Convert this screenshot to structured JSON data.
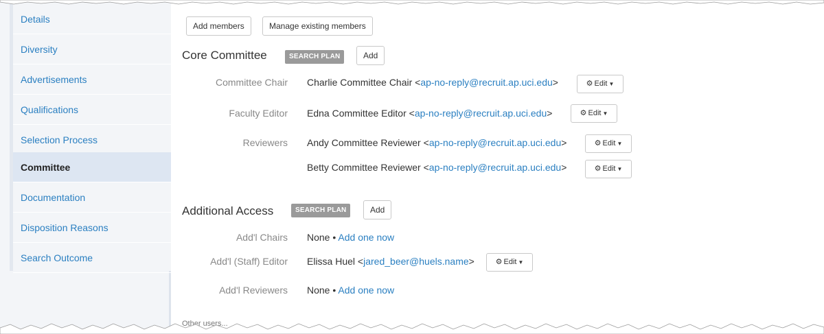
{
  "sidebar": {
    "items": [
      {
        "label": "Details",
        "active": false
      },
      {
        "label": "Diversity",
        "active": false
      },
      {
        "label": "Advertisements",
        "active": false
      },
      {
        "label": "Qualifications",
        "active": false
      },
      {
        "label": "Selection Process",
        "active": false
      },
      {
        "label": "Committee",
        "active": true
      },
      {
        "label": "Documentation",
        "active": false
      },
      {
        "label": "Disposition Reasons",
        "active": false
      },
      {
        "label": "Search Outcome",
        "active": false
      }
    ]
  },
  "toolbar": {
    "add_members": "Add members",
    "manage_members": "Manage existing members"
  },
  "core": {
    "title": "Core Committee",
    "badge": "SEARCH PLAN",
    "add": "Add",
    "chair_label": "Committee Chair",
    "chair_name": "Charlie Committee Chair",
    "chair_email": "ap-no-reply@recruit.ap.uci.edu",
    "editor_label": "Faculty Editor",
    "editor_name": "Edna Committee Editor",
    "editor_email": "ap-no-reply@recruit.ap.uci.edu",
    "reviewers_label": "Reviewers",
    "reviewer1_name": "Andy Committee Reviewer",
    "reviewer1_email": "ap-no-reply@recruit.ap.uci.edu",
    "reviewer2_name": "Betty Committee Reviewer",
    "reviewer2_email": "ap-no-reply@recruit.ap.uci.edu"
  },
  "additional": {
    "title": "Additional Access",
    "badge": "SEARCH PLAN",
    "add": "Add",
    "chairs_label": "Add'l Chairs",
    "chairs_none": "None",
    "chairs_link": "Add one now",
    "staff_label": "Add'l (Staff) Editor",
    "staff_name": "Elissa Huel",
    "staff_email": "jared_beer@huels.name",
    "reviewers_label": "Add'l Reviewers",
    "reviewers_none": "None",
    "reviewers_link": "Add one now"
  },
  "edit_label": "Edit",
  "footer": {
    "other_users": "Other users..."
  }
}
